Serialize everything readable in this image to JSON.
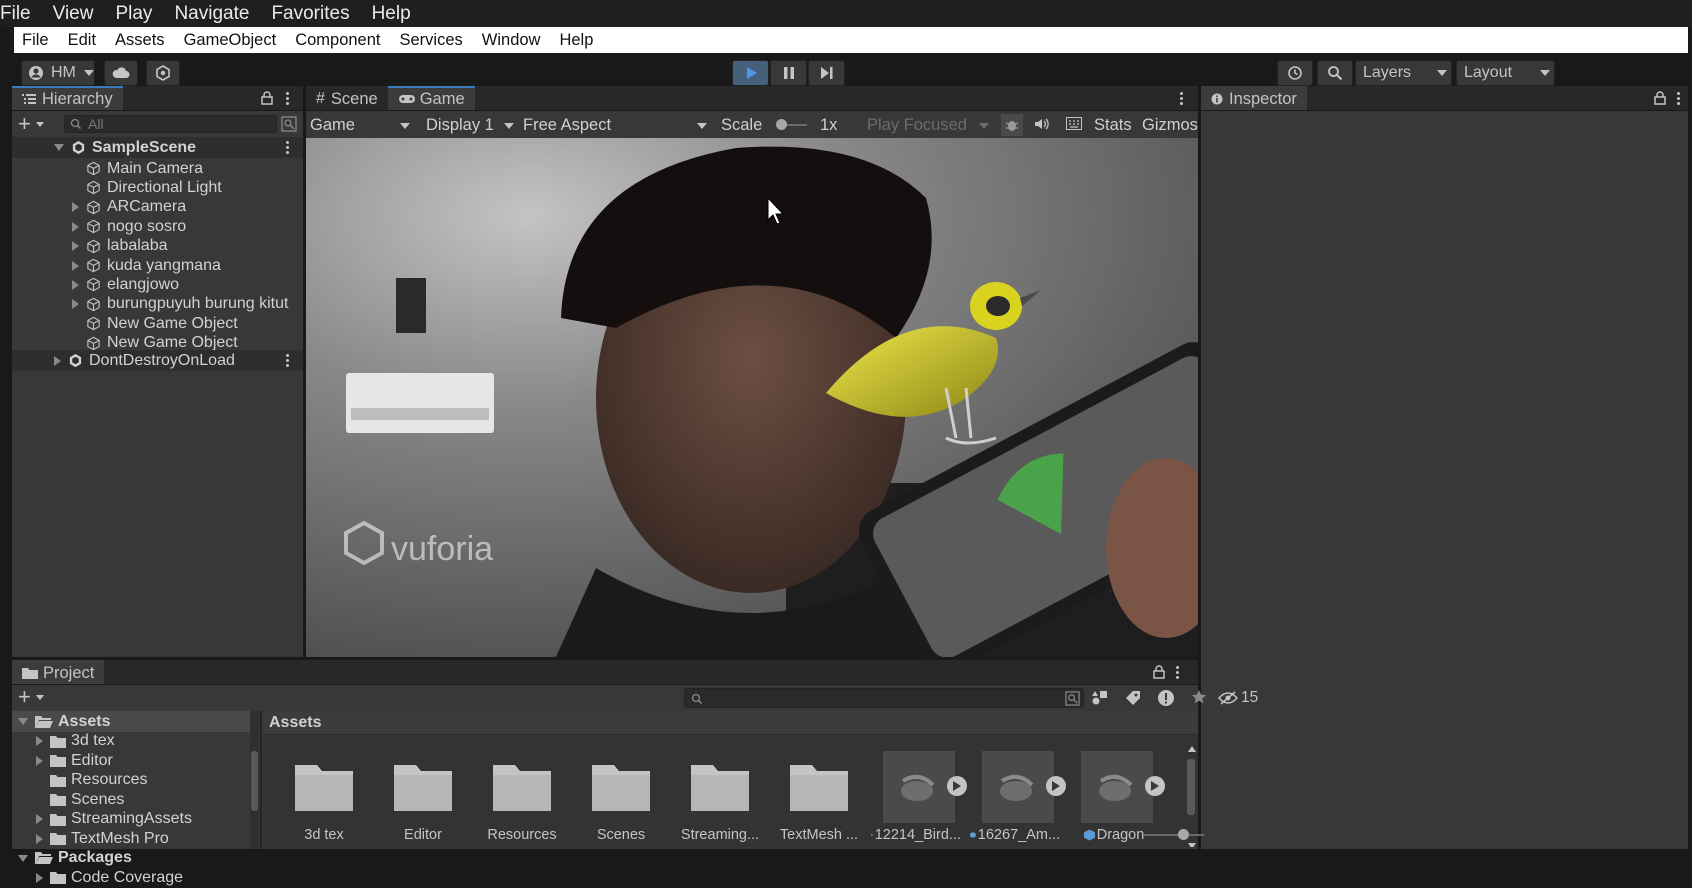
{
  "outer_menu": [
    "File",
    "View",
    "Play",
    "Navigate",
    "Favorites",
    "Help"
  ],
  "unity_menu": [
    "File",
    "Edit",
    "Assets",
    "GameObject",
    "Component",
    "Services",
    "Window",
    "Help"
  ],
  "toolbar": {
    "account_label": "HM",
    "layers_label": "Layers",
    "layout_label": "Layout"
  },
  "hierarchy": {
    "tab_label": "Hierarchy",
    "search_placeholder": "All",
    "scene_name": "SampleScene",
    "items": [
      "Main Camera",
      "Directional Light",
      "ARCamera",
      "nogo sosro",
      "labalaba",
      "kuda yangmana",
      "elangjowo",
      "burungpuyuh burung kitut",
      "New Game Object",
      "New Game Object"
    ],
    "dont_destroy": "DontDestroyOnLoad"
  },
  "game_view": {
    "tabs": [
      "Scene",
      "Game"
    ],
    "display_mode": "Game",
    "display": "Display 1",
    "aspect": "Free Aspect",
    "scale_label": "Scale",
    "scale_value": "1x",
    "play_focus": "Play Focused",
    "stats_label": "Stats",
    "gizmos_label": "Gizmos",
    "watermark": "vuforia"
  },
  "inspector": {
    "tab_label": "Inspector"
  },
  "project": {
    "tab_label": "Project",
    "hidden_count": "15",
    "breadcrumb": "Assets",
    "tree": [
      {
        "label": "Assets",
        "level": 0,
        "expanded": true
      },
      {
        "label": "3d tex",
        "level": 1,
        "expandable": true
      },
      {
        "label": "Editor",
        "level": 1,
        "expandable": true
      },
      {
        "label": "Resources",
        "level": 1,
        "expandable": false
      },
      {
        "label": "Scenes",
        "level": 1,
        "expandable": false
      },
      {
        "label": "StreamingAssets",
        "level": 1,
        "expandable": true
      },
      {
        "label": "TextMesh Pro",
        "level": 1,
        "expandable": true
      },
      {
        "label": "Packages",
        "level": 0,
        "expanded": true
      },
      {
        "label": "Code Coverage",
        "level": 1,
        "expandable": true
      }
    ],
    "folders": [
      "3d tex",
      "Editor",
      "Resources",
      "Scenes",
      "Streaming...",
      "TextMesh ..."
    ],
    "models": [
      "12214_Bird...",
      "16267_Am...",
      "Dragon"
    ]
  },
  "colors": {
    "accent": "#3a79bb",
    "panel": "#383838",
    "header": "#282828",
    "bird": "#d9d21f"
  }
}
